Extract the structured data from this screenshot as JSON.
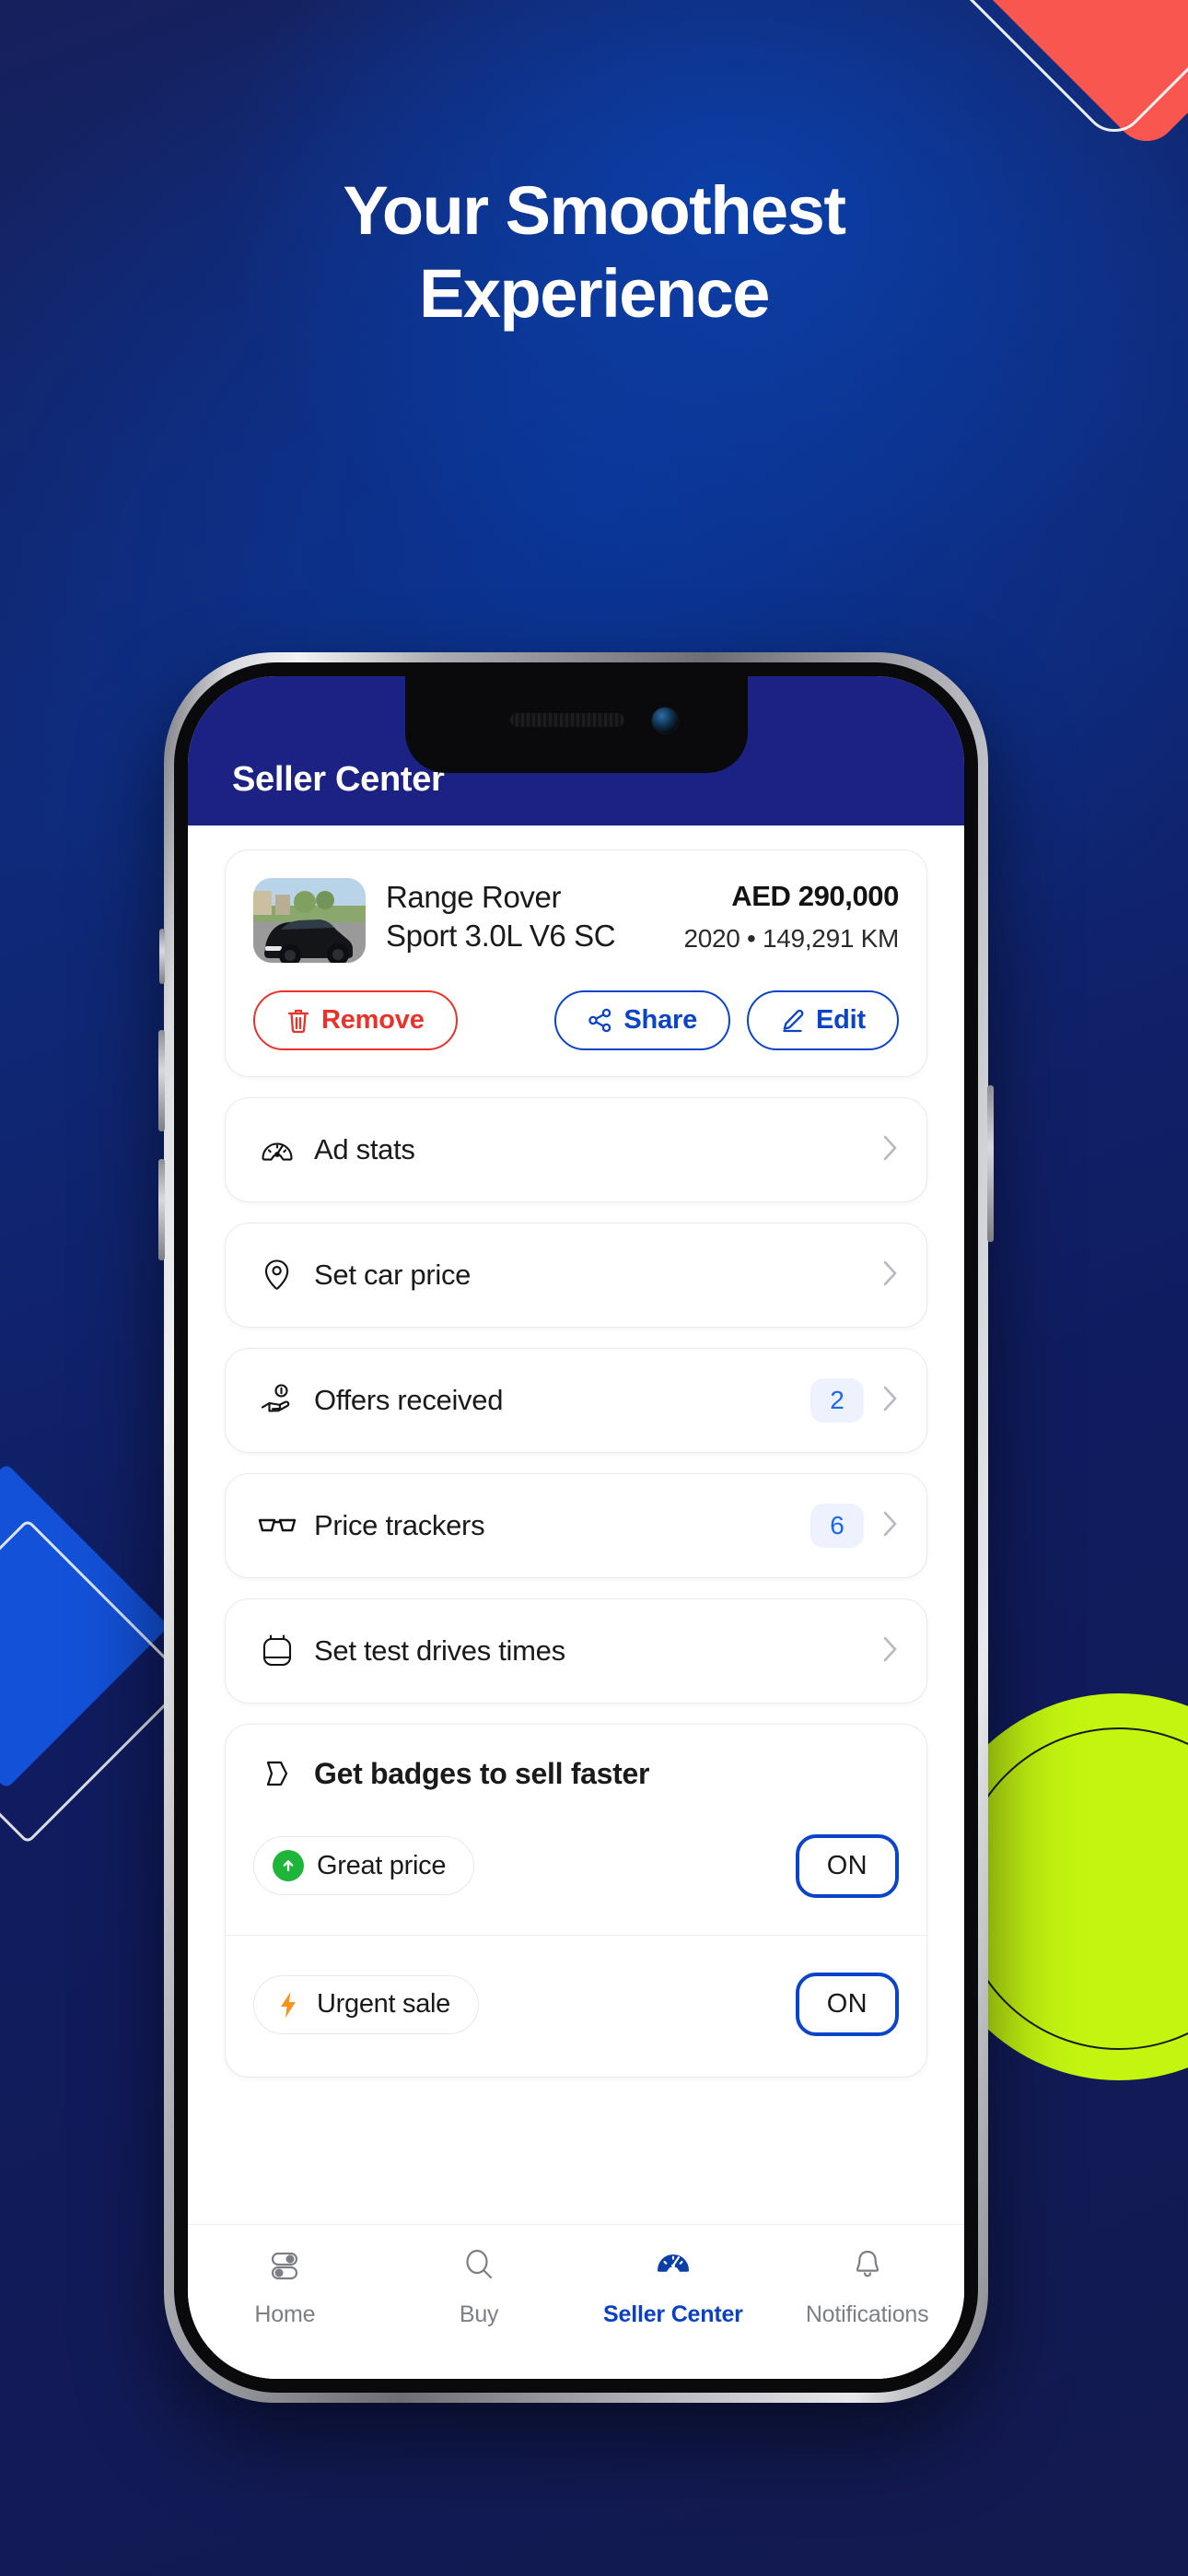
{
  "promo": {
    "headline_line1": "Your Smoothest",
    "headline_line2": "Experience",
    "bg_color": "#131a4f",
    "accent_red": "#f9564f",
    "accent_lime": "#c3f511",
    "accent_blue": "#1351d8"
  },
  "app": {
    "header": {
      "title": "Seller Center",
      "bg": "#1b2284"
    },
    "listing": {
      "title_line1": "Range Rover",
      "title_line2": "Sport 3.0L V6 SC",
      "price": "AED 290,000",
      "meta": "2020 • 149,291 KM",
      "thumbnail_alt": "black-range-rover-sport",
      "actions": [
        {
          "label": "Remove",
          "icon": "trash-icon",
          "color": "#e8332a"
        },
        {
          "label": "Share",
          "icon": "share-icon",
          "color": "#0b44c9"
        },
        {
          "label": "Edit",
          "icon": "pencil-icon",
          "color": "#0b44c9"
        }
      ]
    },
    "menu": [
      {
        "label": "Ad stats",
        "icon": "speedometer-icon",
        "badge": ""
      },
      {
        "label": "Set car price",
        "icon": "price-tag-icon",
        "badge": ""
      },
      {
        "label": "Offers received",
        "icon": "offer-hand-icon",
        "badge": "2"
      },
      {
        "label": "Price trackers",
        "icon": "glasses-icon",
        "badge": "6"
      },
      {
        "label": "Set test drives times",
        "icon": "calendar-icon",
        "badge": ""
      }
    ],
    "badges_section": {
      "title": "Get badges to sell faster",
      "icon": "badge-tag-icon",
      "items": [
        {
          "label": "Great price",
          "icon": "green-arrow-up-icon",
          "toggle": "ON",
          "icon_color": "#1eb53a"
        },
        {
          "label": "Urgent sale",
          "icon": "orange-bolt-icon",
          "toggle": "ON",
          "icon_color": "#f7941e"
        }
      ]
    },
    "tabbar": [
      {
        "label": "Home",
        "icon": "sliders-icon",
        "active": false
      },
      {
        "label": "Buy",
        "icon": "search-icon",
        "active": false
      },
      {
        "label": "Seller Center",
        "icon": "speedometer-filled-icon",
        "active": true
      },
      {
        "label": "Notifications",
        "icon": "bell-icon",
        "active": false
      }
    ]
  }
}
